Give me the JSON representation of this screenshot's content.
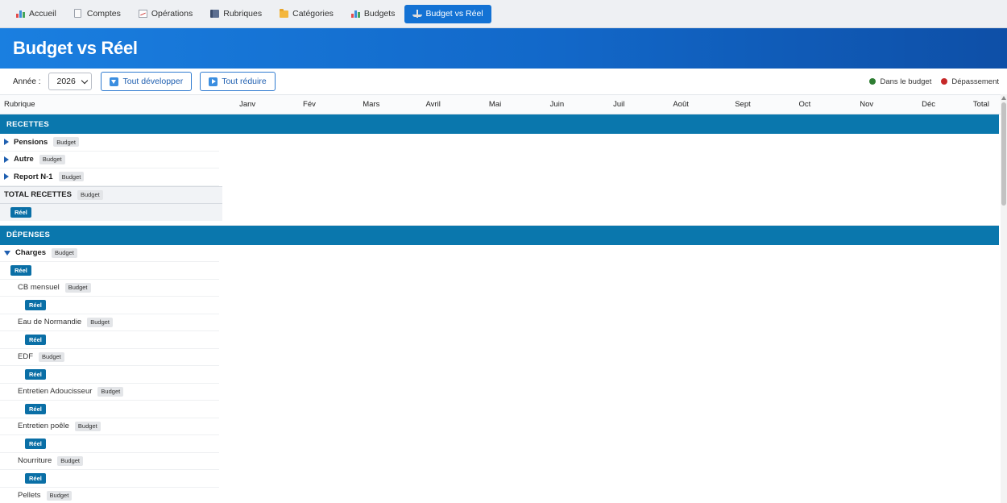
{
  "nav": {
    "items": [
      {
        "label": "Accueil",
        "icon": "bar-chart-icon"
      },
      {
        "label": "Comptes",
        "icon": "document-icon"
      },
      {
        "label": "Opérations",
        "icon": "trend-icon"
      },
      {
        "label": "Rubriques",
        "icon": "book-icon"
      },
      {
        "label": "Catégories",
        "icon": "folder-icon"
      },
      {
        "label": "Budgets",
        "icon": "bar-chart-icon"
      },
      {
        "label": "Budget vs Réel",
        "icon": "scale-icon",
        "active": true
      }
    ]
  },
  "page": {
    "title": "Budget vs Réel"
  },
  "toolbar": {
    "year_label": "Année :",
    "year_value": "2026",
    "expand_label": "Tout développer",
    "collapse_label": "Tout réduire",
    "legend_in_budget": "Dans le budget",
    "legend_over": "Dépassement",
    "colors": {
      "in_budget": "#2e7d32",
      "over": "#c62828"
    }
  },
  "table": {
    "header": {
      "rubrique": "Rubrique",
      "months": [
        "Janv",
        "Fév",
        "Mars",
        "Avril",
        "Mai",
        "Juin",
        "Juil",
        "Août",
        "Sept",
        "Oct",
        "Nov",
        "Déc"
      ],
      "total": "Total"
    },
    "budget_badge": "Budget",
    "reel_badge": "Réel",
    "recettes": {
      "title": "RECETTES",
      "rows": [
        "Pensions",
        "Autre",
        "Report N-1"
      ],
      "total_label": "TOTAL RECETTES"
    },
    "depenses": {
      "title": "DÉPENSES",
      "group": "Charges",
      "items": [
        "CB mensuel",
        "Eau de Normandie",
        "EDF",
        "Entretien Adoucisseur",
        "Entretien poêle",
        "Nourriture",
        "Pellets"
      ]
    }
  }
}
